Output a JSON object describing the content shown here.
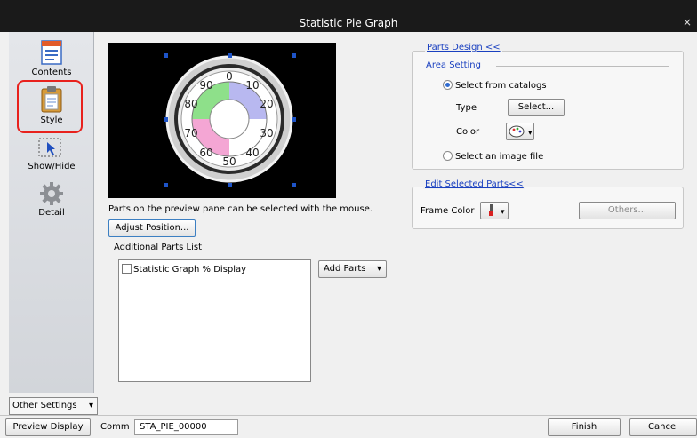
{
  "window": {
    "title": "Statistic Pie Graph",
    "close": "×"
  },
  "sidebar": {
    "items": [
      {
        "label": "Contents",
        "icon": "contents-icon"
      },
      {
        "label": "Style",
        "icon": "clipboard-icon"
      },
      {
        "label": "Show/Hide",
        "icon": "cursor-icon"
      },
      {
        "label": "Detail",
        "icon": "gear-icon"
      }
    ],
    "other_settings": "Other Settings"
  },
  "preview": {
    "dial_labels": [
      "0",
      "10",
      "20",
      "30",
      "40",
      "50",
      "60",
      "70",
      "80",
      "90"
    ],
    "note": "Parts on the preview pane can be selected with the mouse.",
    "adjust_button": "Adjust Position...",
    "colors": {
      "quarter1": "#b8b8f0",
      "quarter2": "#ffffff",
      "quarter3": "#f4a6d4",
      "quarter4": "#8ee08a"
    }
  },
  "parts_list": {
    "label": "Additional Parts List",
    "items": [
      {
        "label": "Statistic Graph % Display",
        "checked": false
      }
    ],
    "add_button": "Add Parts"
  },
  "parts_design": {
    "title": "Parts Design <<",
    "area_setting": "Area Setting",
    "select_catalogs": "Select from catalogs",
    "type_label": "Type",
    "select_button": "Select...",
    "color_label": "Color",
    "select_image": "Select an image file"
  },
  "edit_parts": {
    "title": "Edit Selected Parts<<",
    "frame_color": "Frame Color",
    "others_button": "Others..."
  },
  "bottom": {
    "preview_display": "Preview Display",
    "comm_label": "Comm",
    "comm_value": "STA_PIE_00000",
    "finish": "Finish",
    "cancel": "Cancel"
  }
}
